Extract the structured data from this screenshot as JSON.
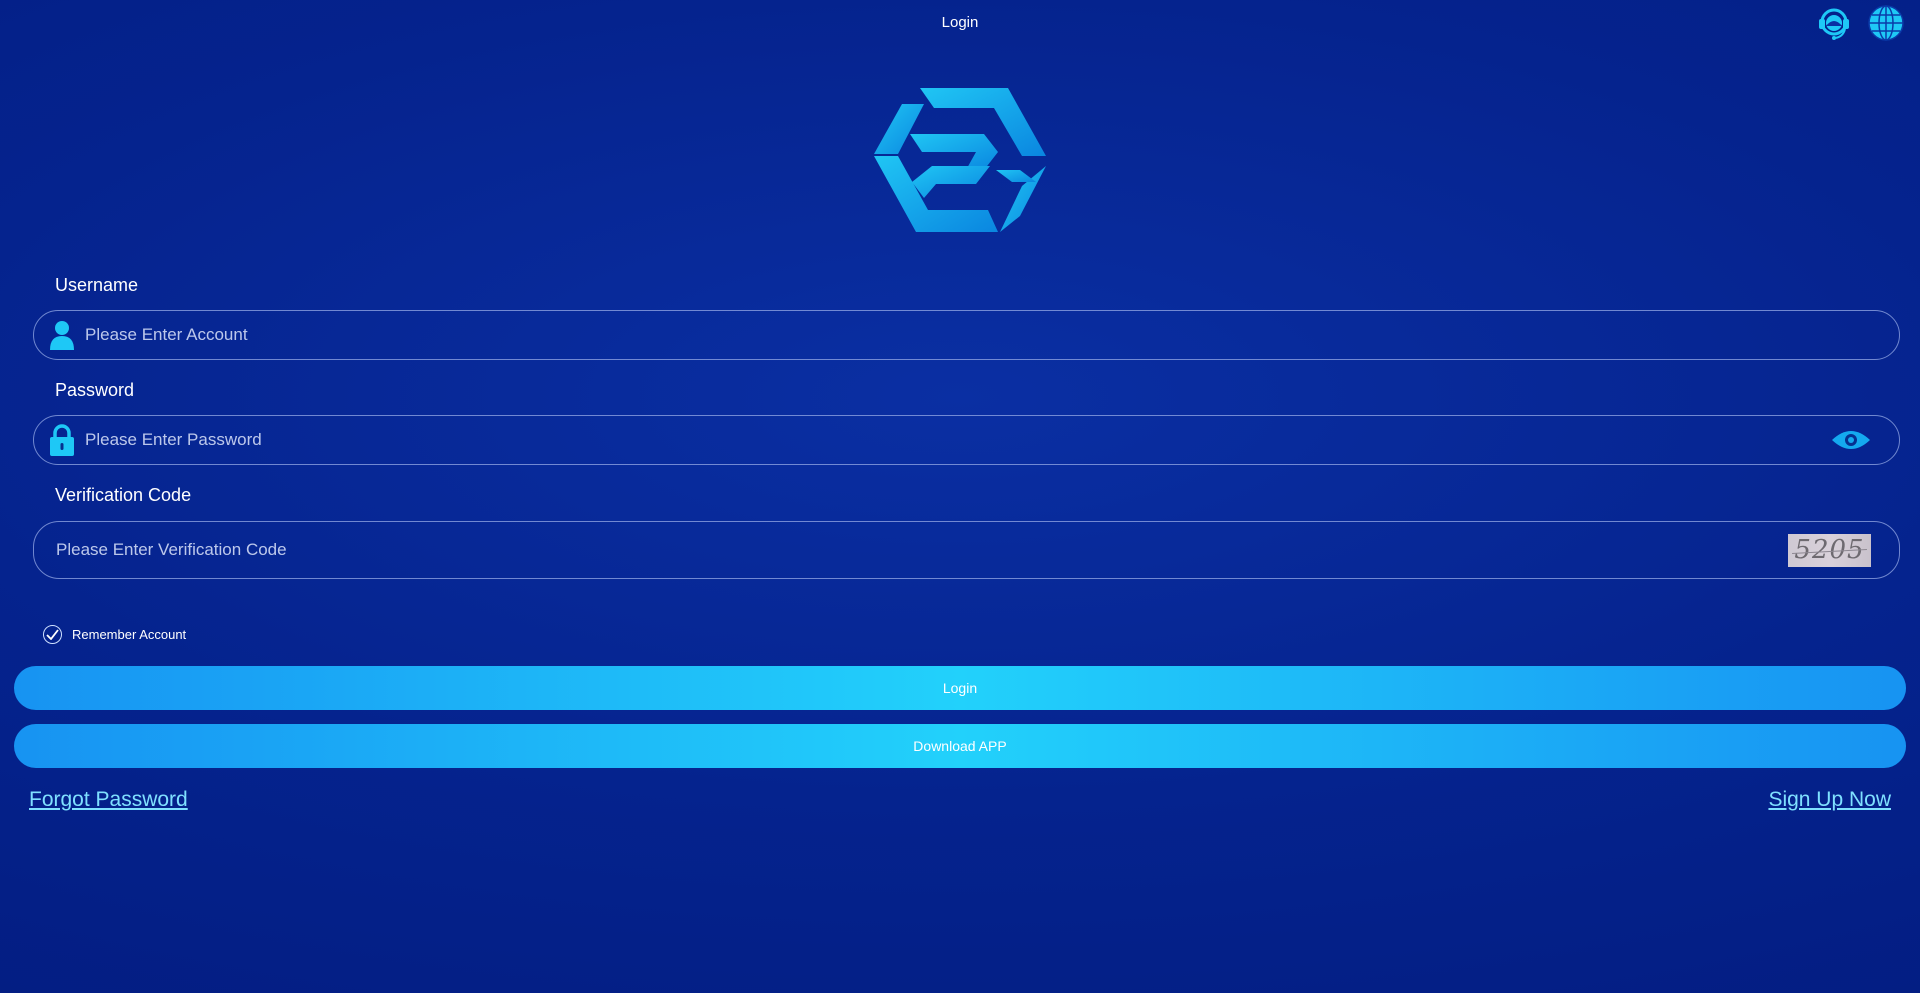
{
  "header": {
    "title": "Login",
    "icons": [
      "customer-service-icon",
      "globe-icon"
    ]
  },
  "form": {
    "username": {
      "label": "Username",
      "placeholder": "Please Enter Account",
      "value": ""
    },
    "password": {
      "label": "Password",
      "placeholder": "Please Enter Password",
      "value": ""
    },
    "verification": {
      "label": "Verification Code",
      "placeholder": "Please Enter Verification Code",
      "value": "",
      "captcha_text": "5205"
    },
    "remember": {
      "label": "Remember Account",
      "checked": true
    }
  },
  "actions": {
    "login_label": "Login",
    "download_label": "Download APP"
  },
  "links": {
    "forgot_password": "Forgot Password",
    "sign_up": "Sign Up Now"
  },
  "colors": {
    "accent": "#22d1fb",
    "link": "#7fe0ff",
    "background": "#05238e"
  }
}
